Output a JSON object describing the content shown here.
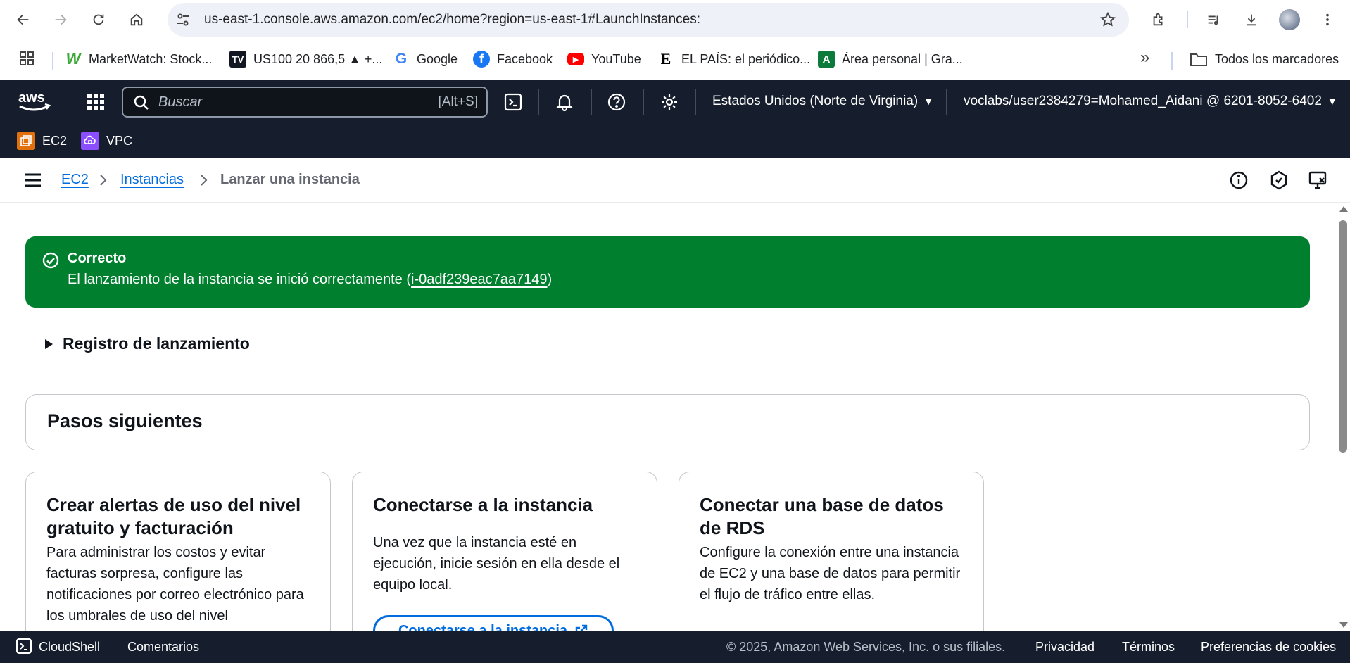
{
  "browser": {
    "url": "us-east-1.console.aws.amazon.com/ec2/home?region=us-east-1#LaunchInstances:",
    "bookmarks": [
      {
        "label": "MarketWatch: Stock...",
        "icon": "marketwatch-icon"
      },
      {
        "label": "US100 20 866,5 ▲ +...",
        "icon": "tradingview-icon"
      },
      {
        "label": "Google",
        "icon": "google-icon"
      },
      {
        "label": "Facebook",
        "icon": "facebook-icon"
      },
      {
        "label": "YouTube",
        "icon": "youtube-icon"
      },
      {
        "label": "EL PAÍS: el periódico...",
        "icon": "elpais-icon"
      },
      {
        "label": "Área personal | Gra...",
        "icon": "area-personal-icon"
      }
    ],
    "all_bookmarks": "Todos los marcadores"
  },
  "aws_nav": {
    "search_placeholder": "Buscar",
    "search_shortcut": "[Alt+S]",
    "region": "Estados Unidos (Norte de Virginia)",
    "account": "voclabs/user2384279=Mohamed_Aidani @ 6201-8052-6402"
  },
  "services": [
    {
      "label": "EC2",
      "color": "#e0710d"
    },
    {
      "label": "VPC",
      "color": "#8c4fff"
    }
  ],
  "breadcrumb": {
    "items": [
      "EC2",
      "Instancias"
    ],
    "current": "Lanzar una instancia"
  },
  "flash": {
    "title": "Correcto",
    "message_prefix": "El lanzamiento de la instancia se inició correctamente (",
    "instance_id": "i-0adf239eac7aa7149",
    "message_suffix": ")",
    "color": "#00802f"
  },
  "launch_log": "Registro de lanzamiento",
  "next_steps": {
    "title": "Pasos siguientes",
    "cards": [
      {
        "title": "Crear alertas de uso del nivel gratuito y facturación",
        "body": "Para administrar los costos y evitar facturas sorpresa, configure las notificaciones por correo electrónico para los umbrales de uso del nivel"
      },
      {
        "title": "Conectarse a la instancia",
        "body": "Una vez que la instancia esté en ejecución, inicie sesión en ella desde el equipo local.",
        "button": "Conectarse a la instancia"
      },
      {
        "title": "Conectar una base de datos de RDS",
        "body": "Configure la conexión entre una instancia de EC2 y una base de datos para permitir el flujo de tráfico entre ellas."
      }
    ]
  },
  "footer": {
    "cloudshell": "CloudShell",
    "feedback": "Comentarios",
    "copyright": "© 2025, Amazon Web Services, Inc. o sus filiales.",
    "privacy": "Privacidad",
    "terms": "Términos",
    "cookies": "Preferencias de cookies"
  }
}
